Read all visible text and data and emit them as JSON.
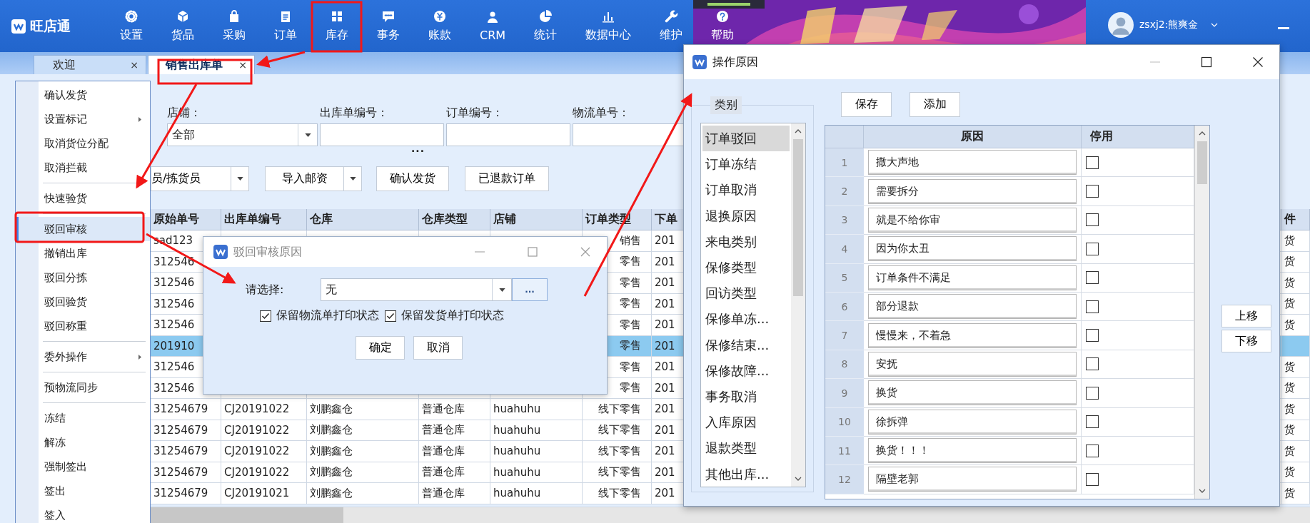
{
  "app_bar": {
    "logo_text": "旺店通",
    "user": "zsxj2:熊爽金",
    "nav": [
      {
        "label": "设置"
      },
      {
        "label": "货品"
      },
      {
        "label": "采购"
      },
      {
        "label": "订单"
      },
      {
        "label": "库存"
      },
      {
        "label": "事务"
      },
      {
        "label": "账款"
      },
      {
        "label": "CRM"
      },
      {
        "label": "统计"
      },
      {
        "label": "数据中心"
      },
      {
        "label": "维护"
      },
      {
        "label": "帮助"
      }
    ]
  },
  "tabs": [
    {
      "label": "欢迎",
      "close": "×",
      "selected": false
    },
    {
      "label": "销售出库单",
      "close": "×",
      "selected": true
    }
  ],
  "filters": [
    {
      "label": "店铺：",
      "kind": "select",
      "value": "全部"
    },
    {
      "label": "出库单编号：",
      "kind": "text"
    },
    {
      "label": "订单编号：",
      "kind": "text"
    },
    {
      "label": "物流单号：",
      "kind": "text"
    }
  ],
  "more_toggle": "···",
  "toolbar": [
    {
      "label": "员/拣货员",
      "kind": "split"
    },
    {
      "label": "导入邮资",
      "kind": "split"
    },
    {
      "label": "确认发货",
      "kind": "button"
    },
    {
      "label": "已退款订单",
      "kind": "button"
    }
  ],
  "table": {
    "columns": [
      "原始单号",
      "出库单编号",
      "仓库",
      "仓库类型",
      "店铺",
      "订单类型",
      "下单",
      "件"
    ],
    "rows": [
      {
        "selected": false,
        "original_no": "sad123",
        "order_type": "销售",
        "order_date": "201",
        "column_8": "货"
      },
      {
        "selected": false,
        "original_no": "312546",
        "order_type": "零售",
        "order_date": "201",
        "column_8": "货"
      },
      {
        "selected": false,
        "original_no": "312546",
        "order_type": "零售",
        "order_date": "201",
        "column_8": "货"
      },
      {
        "selected": false,
        "original_no": "312546",
        "order_type": "零售",
        "order_date": "201",
        "column_8": "货"
      },
      {
        "selected": false,
        "original_no": "312546",
        "order_type": "零售",
        "order_date": "201",
        "column_8": "货"
      },
      {
        "selected": true,
        "original_no": "201910",
        "order_type": "零售",
        "order_date": "201"
      },
      {
        "selected": false,
        "original_no": "312546",
        "order_type": "零售",
        "order_date": "201",
        "column_8": "货"
      },
      {
        "selected": false,
        "original_no": "312546",
        "order_type": "零售",
        "order_date": "201",
        "column_8": "货"
      },
      {
        "selected": false,
        "original_no": "31254679",
        "outbound_no": "CJ20191022",
        "warehouse": "刘鹏鑫仓",
        "warehouse_type": "普通仓库",
        "shop": "huahuhu",
        "order_type": "线下零售",
        "order_date": "201",
        "column_8": "货"
      },
      {
        "selected": false,
        "original_no": "31254679",
        "outbound_no": "CJ20191022",
        "warehouse": "刘鹏鑫仓",
        "warehouse_type": "普通仓库",
        "shop": "huahuhu",
        "order_type": "线下零售",
        "order_date": "201",
        "column_8": "货"
      },
      {
        "selected": false,
        "original_no": "31254679",
        "outbound_no": "CJ20191022",
        "warehouse": "刘鹏鑫仓",
        "warehouse_type": "普通仓库",
        "shop": "huahuhu",
        "order_type": "线下零售",
        "order_date": "201",
        "column_8": "货"
      },
      {
        "selected": false,
        "original_no": "31254679",
        "outbound_no": "CJ20191022",
        "warehouse": "刘鹏鑫仓",
        "warehouse_type": "普通仓库",
        "shop": "huahuhu",
        "order_type": "线下零售",
        "order_date": "201",
        "column_8": "货"
      },
      {
        "selected": false,
        "original_no": "31254679",
        "outbound_no": "CJ20191021",
        "warehouse": "刘鹏鑫仓",
        "warehouse_type": "普通仓库",
        "shop": "huahuhu",
        "order_type": "线下零售",
        "order_date": "201",
        "column_8": "货"
      }
    ]
  },
  "context_menu": [
    {
      "kind": "item",
      "label": "确认发货",
      "submenu": false,
      "selected": false
    },
    {
      "kind": "item",
      "label": "设置标记",
      "submenu": true,
      "selected": false
    },
    {
      "kind": "item",
      "label": "取消货位分配",
      "submenu": false,
      "selected": false
    },
    {
      "kind": "item",
      "label": "取消拦截",
      "submenu": false,
      "selected": false
    },
    {
      "kind": "separator"
    },
    {
      "kind": "item",
      "label": "快速验货",
      "submenu": false,
      "selected": false
    },
    {
      "kind": "separator"
    },
    {
      "kind": "item",
      "label": "驳回审核",
      "submenu": false,
      "selected": true
    },
    {
      "kind": "item",
      "label": "撤销出库",
      "submenu": false,
      "selected": false
    },
    {
      "kind": "item",
      "label": "驳回分拣",
      "submenu": false,
      "selected": false
    },
    {
      "kind": "item",
      "label": "驳回验货",
      "submenu": false,
      "selected": false
    },
    {
      "kind": "item",
      "label": "驳回称重",
      "submenu": false,
      "selected": false
    },
    {
      "kind": "separator"
    },
    {
      "kind": "item",
      "label": "委外操作",
      "submenu": true,
      "selected": false
    },
    {
      "kind": "separator"
    },
    {
      "kind": "item",
      "label": "预物流同步",
      "submenu": false,
      "selected": false
    },
    {
      "kind": "separator"
    },
    {
      "kind": "item",
      "label": "冻结",
      "submenu": false,
      "selected": false
    },
    {
      "kind": "item",
      "label": "解冻",
      "submenu": false,
      "selected": false
    },
    {
      "kind": "item",
      "label": "强制签出",
      "submenu": false,
      "selected": false
    },
    {
      "kind": "item",
      "label": "签出",
      "submenu": false,
      "selected": false
    },
    {
      "kind": "item",
      "label": "签入",
      "submenu": false,
      "selected": false
    }
  ],
  "reject_dialog": {
    "title": "驳回审核原因",
    "select_label": "请选择:",
    "select_value": "无",
    "browse": "...",
    "checkboxes": [
      {
        "label": "保留物流单打印状态",
        "checked": true
      },
      {
        "label": "保留发货单打印状态",
        "checked": true
      }
    ],
    "buttons": [
      "确定",
      "取消"
    ]
  },
  "reasons_window": {
    "title": "操作原因",
    "category_label": "类别",
    "categories": [
      {
        "label": "订单驳回",
        "selected": true
      },
      {
        "label": "订单冻结",
        "selected": false
      },
      {
        "label": "订单取消",
        "selected": false
      },
      {
        "label": "退换原因",
        "selected": false
      },
      {
        "label": "来电类别",
        "selected": false
      },
      {
        "label": "保修类型",
        "selected": false
      },
      {
        "label": "回访类型",
        "selected": false
      },
      {
        "label": "保修单冻...",
        "selected": false
      },
      {
        "label": "保修结束...",
        "selected": false
      },
      {
        "label": "保修故障...",
        "selected": false
      },
      {
        "label": "事务取消",
        "selected": false
      },
      {
        "label": "入库原因",
        "selected": false
      },
      {
        "label": "退款类型",
        "selected": false
      },
      {
        "label": "其他出库...",
        "selected": false
      }
    ],
    "buttons": [
      "保存",
      "添加"
    ],
    "columns": [
      "原因",
      "停用"
    ],
    "rows": [
      {
        "num": "1",
        "reason": "撒大声地",
        "checked": false
      },
      {
        "num": "2",
        "reason": "需要拆分",
        "checked": false
      },
      {
        "num": "3",
        "reason": "就是不给你审",
        "checked": false
      },
      {
        "num": "4",
        "reason": "因为你太丑",
        "checked": false
      },
      {
        "num": "5",
        "reason": "订单条件不满足",
        "checked": false
      },
      {
        "num": "6",
        "reason": "部分退款",
        "checked": false
      },
      {
        "num": "7",
        "reason": "慢慢来，不着急",
        "checked": false
      },
      {
        "num": "8",
        "reason": "安抚",
        "checked": false
      },
      {
        "num": "9",
        "reason": "换货",
        "checked": false
      },
      {
        "num": "10",
        "reason": "徐拆弹",
        "checked": false
      },
      {
        "num": "11",
        "reason": "换货！！！",
        "checked": false
      },
      {
        "num": "12",
        "reason": "隔壁老郭",
        "checked": false
      }
    ],
    "side_buttons": [
      "上移",
      "下移"
    ]
  }
}
